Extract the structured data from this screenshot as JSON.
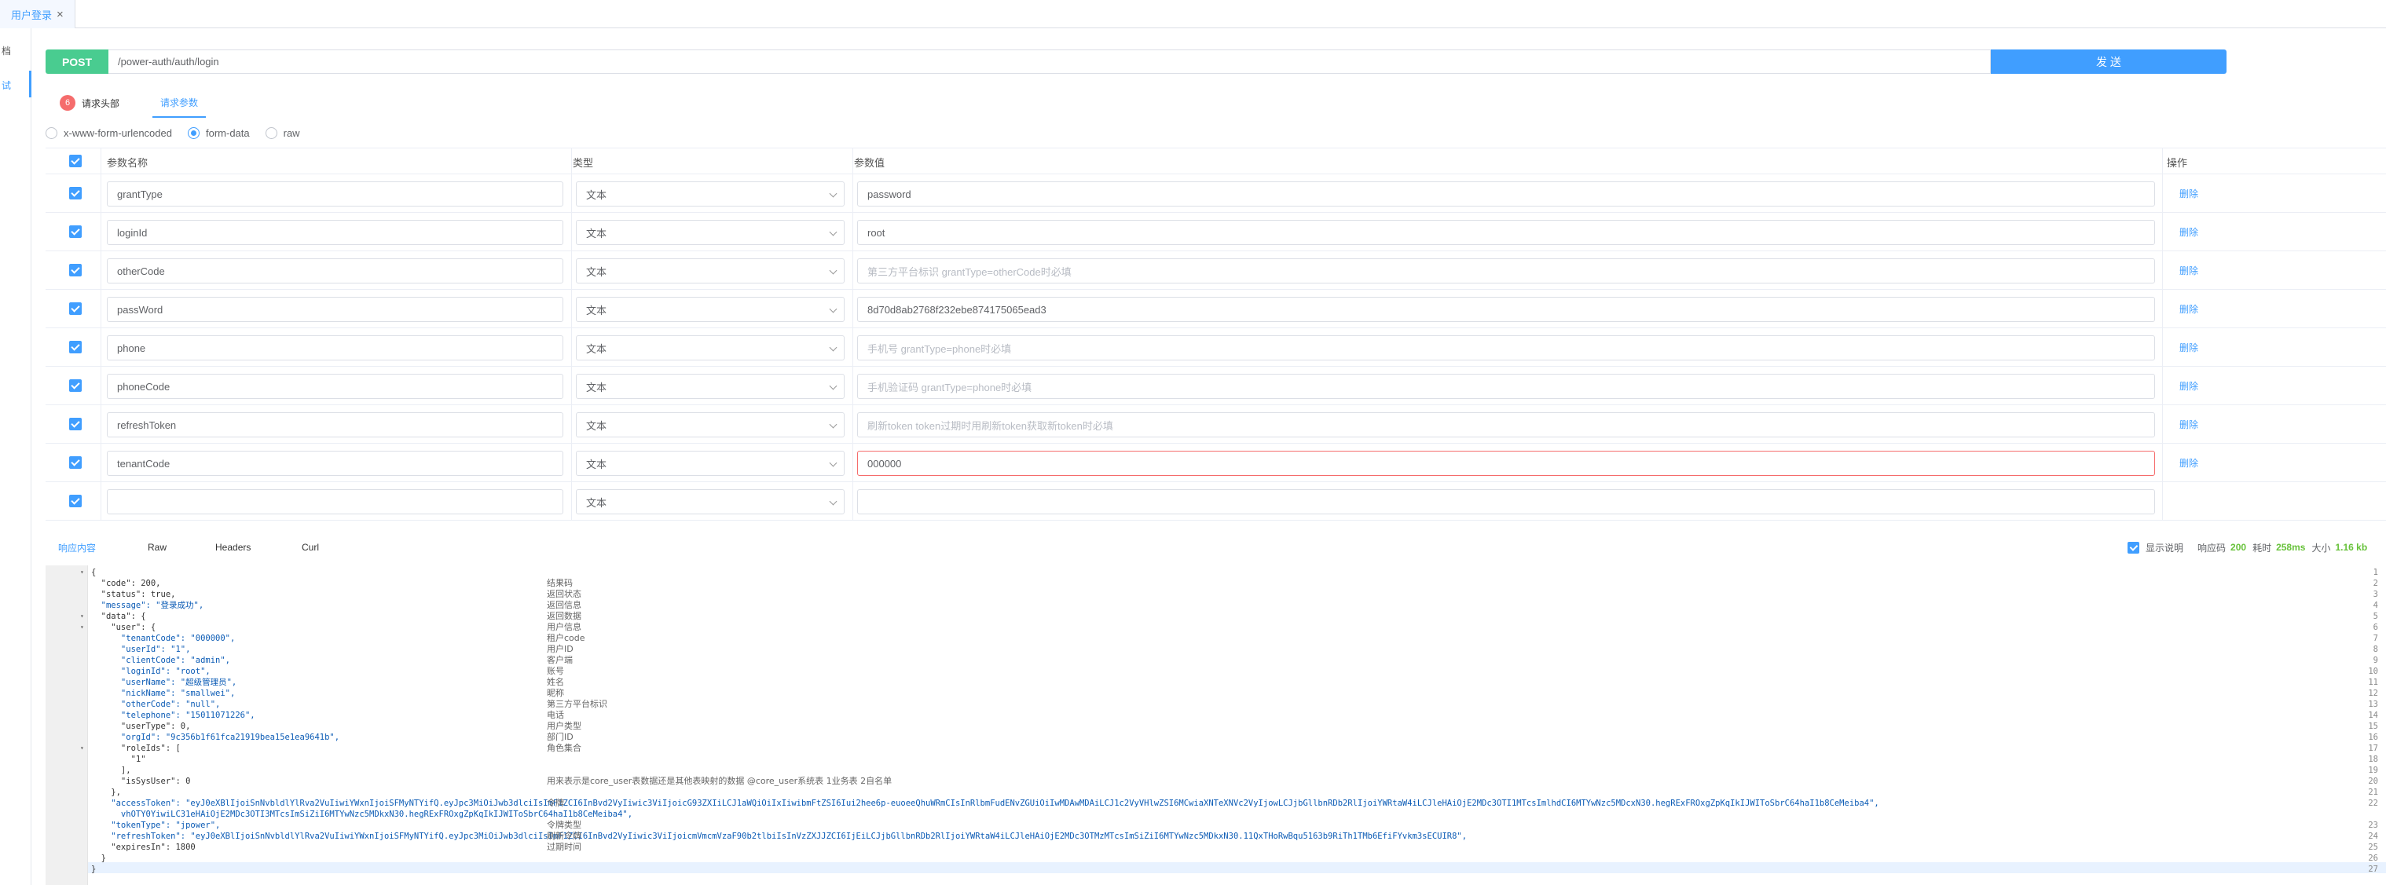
{
  "tab": {
    "title": "用户登录",
    "close": "×"
  },
  "leftnav": {
    "item1": "档",
    "item2": "试"
  },
  "request": {
    "method": "POST",
    "url": "/power-auth/auth/login",
    "send_label": "发 送"
  },
  "req_tabs": {
    "headers_badge": "6",
    "headers_label": "请求头部",
    "params_label": "请求参数"
  },
  "body_types": [
    {
      "label": "x-www-form-urlencoded",
      "selected": false
    },
    {
      "label": "form-data",
      "selected": true
    },
    {
      "label": "raw",
      "selected": false
    }
  ],
  "params_table": {
    "headers": {
      "name": "参数名称",
      "type": "类型",
      "value": "参数值",
      "action": "操作"
    },
    "rows": [
      {
        "name": "grantType",
        "type": "文本",
        "value": "password",
        "placeholder": "",
        "action": "删除"
      },
      {
        "name": "loginId",
        "type": "文本",
        "value": "root",
        "placeholder": "",
        "action": "删除"
      },
      {
        "name": "otherCode",
        "type": "文本",
        "value": "",
        "placeholder": "第三方平台标识  grantType=otherCode时必填",
        "action": "删除"
      },
      {
        "name": "passWord",
        "type": "文本",
        "value": "8d70d8ab2768f232ebe874175065ead3",
        "placeholder": "",
        "action": "删除"
      },
      {
        "name": "phone",
        "type": "文本",
        "value": "",
        "placeholder": "手机号   grantType=phone时必填",
        "action": "删除"
      },
      {
        "name": "phoneCode",
        "type": "文本",
        "value": "",
        "placeholder": "手机验证码   grantType=phone时必填",
        "action": "删除"
      },
      {
        "name": "refreshToken",
        "type": "文本",
        "value": "",
        "placeholder": "刷新token   token过期时用刷新token获取新token时必填",
        "action": "删除"
      },
      {
        "name": "tenantCode",
        "type": "文本",
        "value": "000000",
        "placeholder": "",
        "action": "删除"
      },
      {
        "name": "",
        "type": "文本",
        "value": "",
        "placeholder": "",
        "action": ""
      }
    ]
  },
  "response": {
    "tabs": [
      "响应内容",
      "Raw",
      "Headers",
      "Curl"
    ],
    "show_desc_label": "显示说明",
    "status_label": "响应码",
    "status_value": "200",
    "time_label": "耗时",
    "time_value": "258ms",
    "size_label": "大小",
    "size_value": "1.16 kb",
    "lines": [
      {
        "no": "1",
        "fold": true,
        "code": "{",
        "comment": ""
      },
      {
        "no": "2",
        "code": "  \"code\": 200,",
        "comment": "结果码"
      },
      {
        "no": "3",
        "code": "  \"status\": true,",
        "comment": "返回状态"
      },
      {
        "no": "4",
        "code": "  \"message\": \"登录成功\",",
        "comment": "返回信息"
      },
      {
        "no": "5",
        "fold": true,
        "code": "  \"data\": {",
        "comment": "返回数据"
      },
      {
        "no": "6",
        "fold": true,
        "code": "    \"user\": {",
        "comment": "用户信息"
      },
      {
        "no": "7",
        "code": "      \"tenantCode\": \"000000\",",
        "comment": "租户code"
      },
      {
        "no": "8",
        "code": "      \"userId\": \"1\",",
        "comment": "用户ID"
      },
      {
        "no": "9",
        "code": "      \"clientCode\": \"admin\",",
        "comment": "客户端"
      },
      {
        "no": "10",
        "code": "      \"loginId\": \"root\",",
        "comment": "账号"
      },
      {
        "no": "11",
        "code": "      \"userName\": \"超级管理员\",",
        "comment": "姓名"
      },
      {
        "no": "12",
        "code": "      \"nickName\": \"smallwei\",",
        "comment": "昵称"
      },
      {
        "no": "13",
        "code": "      \"otherCode\": \"null\",",
        "comment": "第三方平台标识"
      },
      {
        "no": "14",
        "code": "      \"telephone\": \"15011071226\",",
        "comment": "电话"
      },
      {
        "no": "15",
        "code": "      \"userType\": 0,",
        "comment": "用户类型"
      },
      {
        "no": "16",
        "code": "      \"orgId\": \"9c356b1f61fca21919bea15e1ea9641b\",",
        "comment": "部门ID"
      },
      {
        "no": "17",
        "fold": true,
        "code": "      \"roleIds\": [",
        "comment": "角色集合"
      },
      {
        "no": "18",
        "code": "        \"1\"",
        "comment": ""
      },
      {
        "no": "19",
        "code": "      ],",
        "comment": ""
      },
      {
        "no": "20",
        "code": "      \"isSysUser\": 0",
        "comment": "用来表示是core_user表数据还是其他表映射的数据 @core_user系统表 1业务表 2自名单"
      },
      {
        "no": "21",
        "code": "    },",
        "comment": ""
      },
      {
        "no": "22",
        "code": "    \"accessToken\": \"eyJ0eXBlIjoiSnNvbldlYlRva2VuIiwiYWxnIjoiSFMyNTYifQ.eyJpc3MiOiJwb3dlciIsImF1ZCI6InBvd2VyIiwic3ViIjoicG93ZXIiLCJ1aWQiOiIxIiwibmFtZSI6Iui2hee6p-euoeeQhuWRmCIsInRlbmFudENvZGUiOiIwMDAwMDAiLCJ1c2VyVHlwZSI6MCwiaXNTeXNVc2VyIjowLCJjbGllbnRDb2RlIjoiYWRtaW4iLCJleHAiOjE2MDc3OTI1MTcsImlhdCI6MTYwNzc5MDcxN30.hegRExFROxgZpKqIkIJWIToSbrC64haI1b8CeMeiba4\",",
        "code2": "      vhOTY0YiwiLC31eHAiOjE2MDc3OTI3MTcsImSiZiI6MTYwNzc5MDkxN30.hegRExFROxgZpKqIkIJWIToSbrC64haI1b8CeMeiba4\",",
        "comment": "令牌"
      },
      {
        "no": "23",
        "code": "    \"tokenType\": \"jpower\",",
        "comment": "令牌类型"
      },
      {
        "no": "24",
        "code": "    \"refreshToken\": \"eyJ0eXBlIjoiSnNvbldlYlRva2VuIiwiYWxnIjoiSFMyNTYifQ.eyJpc3MiOiJwb3dlciIsImF1ZCI6InBvd2VyIiwic3ViIjoicmVmcmVzaF90b2tlbiIsInVzZXJJZCI6IjEiLCJjbGllbnRDb2RlIjoiYWRtaW4iLCJleHAiOjE2MDc3OTMzMTcsImSiZiI6MTYwNzc5MDkxN30.11QxTHoRwBqu5163b9RiTh1TMb6EfiFYvkm3sECUIR8\",",
        "comment": "刷新令牌"
      },
      {
        "no": "25",
        "code": "    \"expiresIn\": 1800",
        "comment": "过期时间"
      },
      {
        "no": "26",
        "code": "  }",
        "comment": ""
      },
      {
        "no": "27",
        "code": "}",
        "comment": ""
      }
    ]
  }
}
